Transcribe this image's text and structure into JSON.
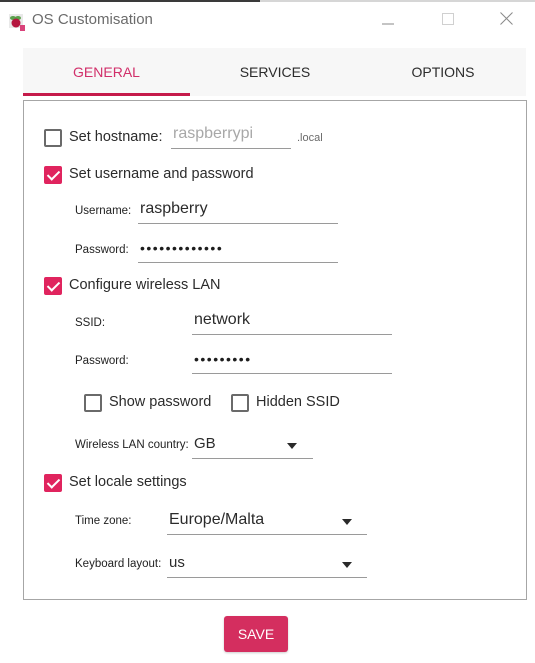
{
  "window": {
    "title": "OS Customisation",
    "app_icon": "raspberry-pi-imager-icon",
    "controls": [
      "minimize-icon",
      "maximize-icon",
      "close-icon"
    ]
  },
  "tabs": [
    {
      "label": "GENERAL",
      "active": true
    },
    {
      "label": "SERVICES",
      "active": false
    },
    {
      "label": "OPTIONS",
      "active": false
    }
  ],
  "general": {
    "hostname": {
      "label": "Set hostname:",
      "checked": false,
      "placeholder": "raspberrypi",
      "value": "",
      "suffix": ".local"
    },
    "user": {
      "label": "Set username and password",
      "checked": true,
      "username_label": "Username:",
      "username_value": "raspberry",
      "password_label": "Password:",
      "password_masked": "•••••••••••••"
    },
    "wlan": {
      "label": "Configure wireless LAN",
      "checked": true,
      "ssid_label": "SSID:",
      "ssid_value": "network",
      "password_label": "Password:",
      "password_masked": "•••••••••",
      "show_password_label": "Show password",
      "show_password_checked": false,
      "hidden_ssid_label": "Hidden SSID",
      "hidden_ssid_checked": false,
      "country_label": "Wireless LAN country:",
      "country_value": "GB"
    },
    "locale": {
      "label": "Set locale settings",
      "checked": true,
      "timezone_label": "Time zone:",
      "timezone_value": "Europe/Malta",
      "keyboard_label": "Keyboard layout:",
      "keyboard_value": "us"
    }
  },
  "actions": {
    "save_label": "SAVE"
  },
  "colors": {
    "accent": "#c51a4a",
    "checkbox": "#e0245e",
    "save_button": "#d42e5f",
    "tab_active_text": "#d12f6a"
  }
}
